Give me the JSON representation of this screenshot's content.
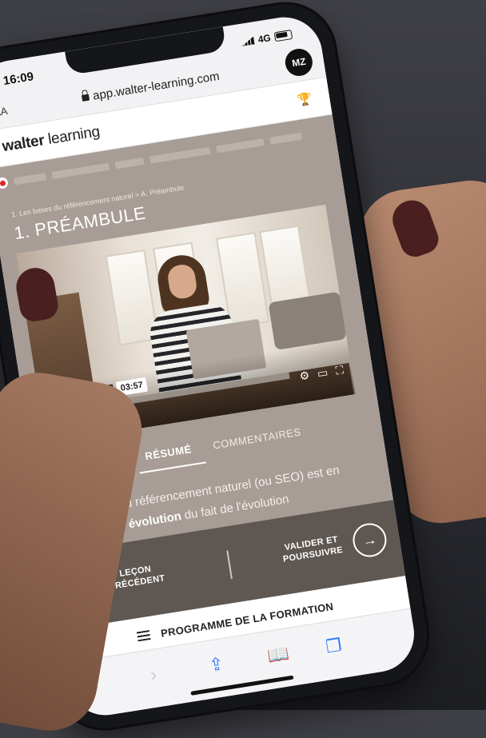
{
  "status": {
    "time": "16:09",
    "network": "4G"
  },
  "browser": {
    "text_size_label": "AA",
    "url": "app.walter-learning.com",
    "reload_icon": "reload-icon",
    "avatar_initials": "MZ"
  },
  "brand": {
    "logo_bold": "walter",
    "logo_light": "learning",
    "trophy_icon": "trophy-icon"
  },
  "lesson": {
    "breadcrumb": "1. Les bases du référencement naturel > A. Préambule",
    "title": "1. PRÉAMBULE"
  },
  "video": {
    "current_time": "03:57",
    "progress": 0.0
  },
  "tabs": [
    {
      "label": "RÉSUMÉ",
      "active": true
    },
    {
      "label": "COMMENTAIRES",
      "active": false
    }
  ],
  "summary": {
    "part1": "La science du référencement naturel (ou SEO) est en ",
    "bold1": "perpétuelle évolution",
    "part2": " du fait de l'évolution"
  },
  "navigation": {
    "prev_line1": "LEÇON",
    "prev_line2": "PRÉCÉDENT",
    "next_line1": "VALIDER ET",
    "next_line2": "POURSUIVRE"
  },
  "program": {
    "label": "PROGRAMME DE LA FORMATION"
  },
  "colors": {
    "accent_blue": "#2f7bf6",
    "content_bg": "#a89d96",
    "nav_bg": "#5e5752"
  }
}
